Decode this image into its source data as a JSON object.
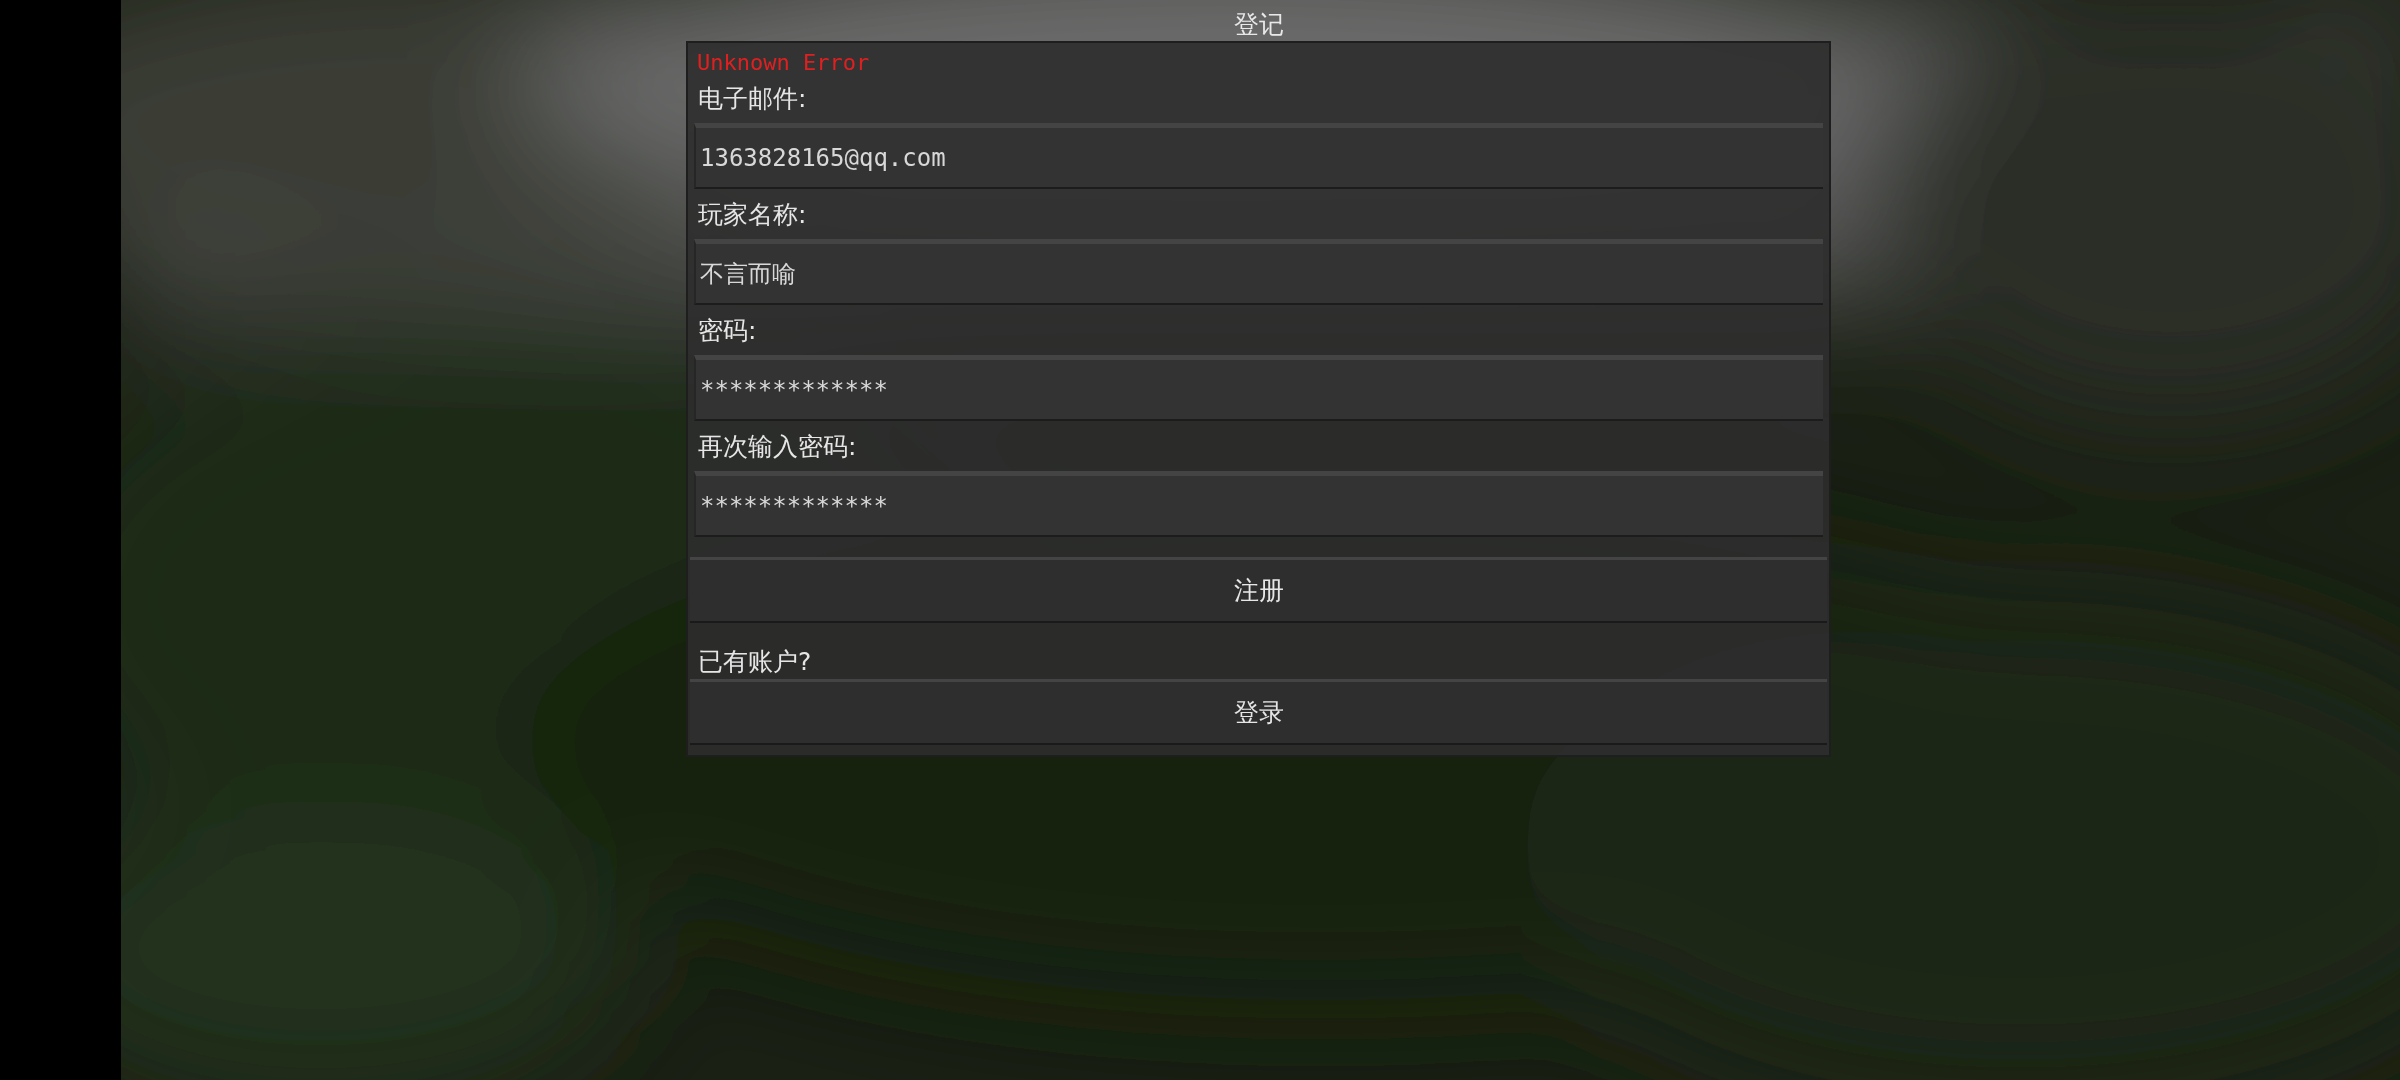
{
  "title": "登记",
  "error": "Unknown Error",
  "fields": [
    {
      "label": "电子邮件:",
      "value": "1363828165@qq.com"
    },
    {
      "label": "玩家名称:",
      "value": "不言而喻"
    },
    {
      "label": "密码:",
      "value": "*************"
    },
    {
      "label": "再次输入密码:",
      "value": "*************"
    }
  ],
  "register_button": "注册",
  "login_prompt": "已有账户?",
  "login_button": "登录"
}
